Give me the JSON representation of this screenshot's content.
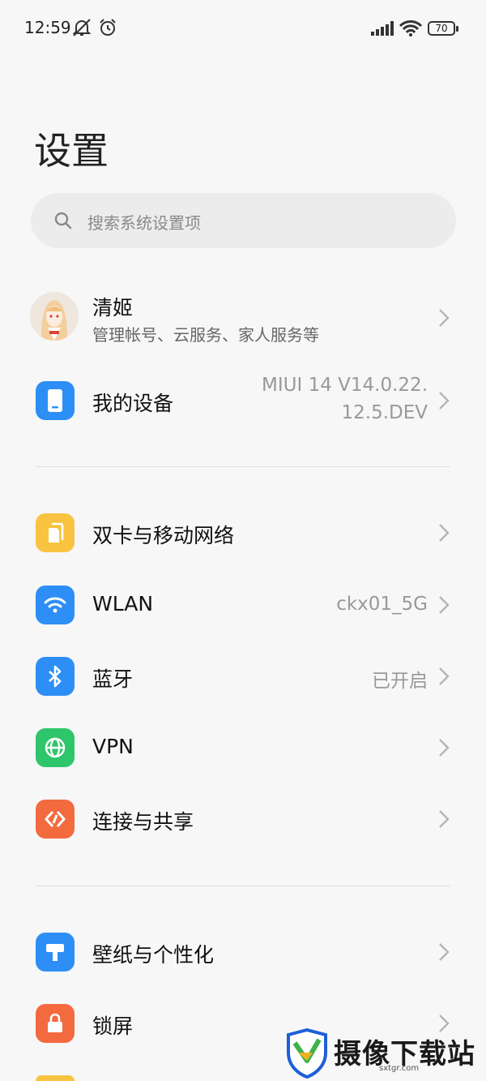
{
  "status_bar": {
    "time": "12:59",
    "battery": "70"
  },
  "page_title": "设置",
  "search": {
    "placeholder": "搜索系统设置项"
  },
  "account": {
    "name": "清姬",
    "subtitle": "管理帐号、云服务、家人服务等"
  },
  "device": {
    "label": "我的设备",
    "value_line1": "MIUI 14 V14.0.22.",
    "value_line2": "12.5.DEV"
  },
  "network": [
    {
      "label": "双卡与移动网络",
      "value": "",
      "icon": "sim-card-icon",
      "color": "#f8c340"
    },
    {
      "label": "WLAN",
      "value": "ckx01_5G",
      "icon": "wifi-icon",
      "color": "#2d8ff5"
    },
    {
      "label": "蓝牙",
      "value": "已开启",
      "icon": "bluetooth-icon",
      "color": "#2d8ff5"
    },
    {
      "label": "VPN",
      "value": "",
      "icon": "globe-icon",
      "color": "#2fc56a"
    },
    {
      "label": "连接与共享",
      "value": "",
      "icon": "share-icon",
      "color": "#f36a3f"
    }
  ],
  "personal": [
    {
      "label": "壁纸与个性化",
      "value": "",
      "icon": "wallpaper-icon",
      "color": "#2d8ff5"
    },
    {
      "label": "锁屏",
      "value": "",
      "icon": "lock-icon",
      "color": "#f36a3f"
    }
  ],
  "watermark": {
    "text": "摄像下载站",
    "site": "sxtgr.com"
  }
}
